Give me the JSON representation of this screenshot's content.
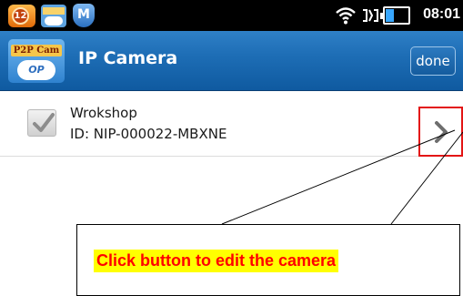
{
  "status_bar": {
    "notification_count": "12",
    "time": "08:01",
    "icons": [
      "notification-badge-icon",
      "p2pcam-app-icon",
      "shield-app-icon",
      "wifi-icon",
      "signal-icon",
      "battery-icon"
    ]
  },
  "title_bar": {
    "logo_tag": "P2P Cam",
    "logo_sub": "OP",
    "title": "IP Camera",
    "done_label": "done"
  },
  "cameras": [
    {
      "name": "Wrokshop",
      "id": "ID: NIP-000022-MBXNE",
      "selected": false
    }
  ],
  "callout": {
    "text": "Click button to edit the camera",
    "text_color": "#ff0000",
    "highlight_color": "#ffff00"
  },
  "colors": {
    "title_bar": "#1e6eb6",
    "edit_highlight_border": "#e31515"
  }
}
